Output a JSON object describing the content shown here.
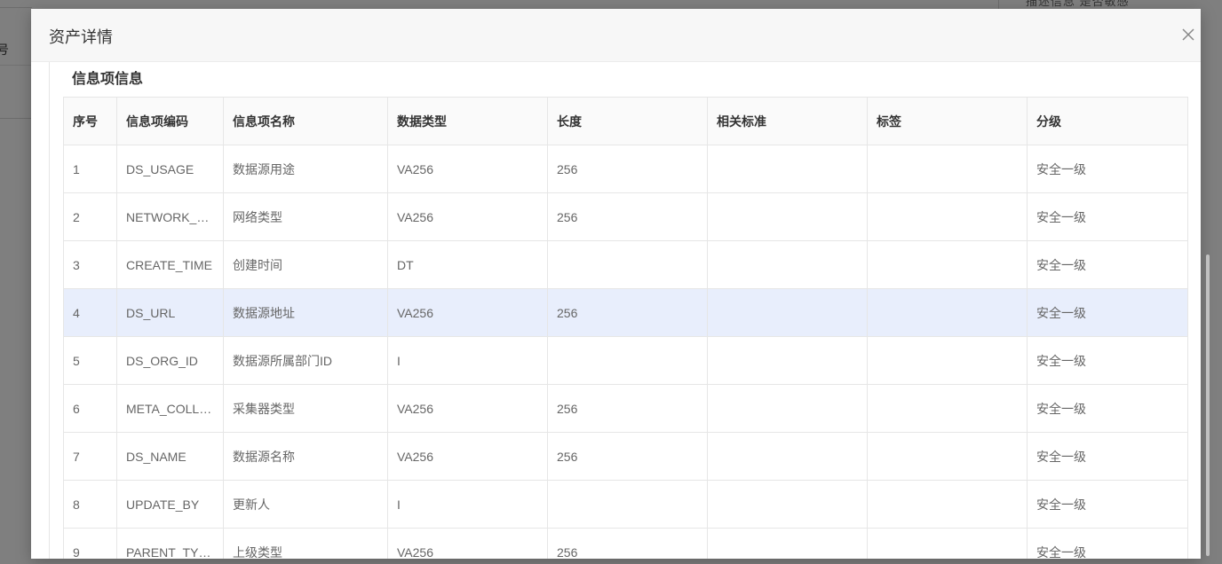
{
  "background": {
    "left_cell_text": "号",
    "top_right_text": "描述信息 是否敏感"
  },
  "modal": {
    "title": "资产详情",
    "close_icon": "close-icon",
    "section": {
      "title": "信息项信息"
    },
    "table": {
      "columns": [
        "序号",
        "信息项编码",
        "信息项名称",
        "数据类型",
        "长度",
        "相关标准",
        "标签",
        "分级"
      ],
      "rows": [
        [
          "1",
          "DS_USAGE",
          "数据源用途",
          "VA256",
          "256",
          "",
          "",
          "安全一级"
        ],
        [
          "2",
          "NETWORK_TYPE",
          "网络类型",
          "VA256",
          "256",
          "",
          "",
          "安全一级"
        ],
        [
          "3",
          "CREATE_TIME",
          "创建时间",
          "DT",
          "",
          "",
          "",
          "安全一级"
        ],
        [
          "4",
          "DS_URL",
          "数据源地址",
          "VA256",
          "256",
          "",
          "",
          "安全一级"
        ],
        [
          "5",
          "DS_ORG_ID",
          "数据源所属部门ID",
          "I",
          "",
          "",
          "",
          "安全一级"
        ],
        [
          "6",
          "META_COLLECTOR_TYPE",
          "采集器类型",
          "VA256",
          "256",
          "",
          "",
          "安全一级"
        ],
        [
          "7",
          "DS_NAME",
          "数据源名称",
          "VA256",
          "256",
          "",
          "",
          "安全一级"
        ],
        [
          "8",
          "UPDATE_BY",
          "更新人",
          "I",
          "",
          "",
          "",
          "安全一级"
        ],
        [
          "9",
          "PARENT_TYPE",
          "上级类型",
          "VA256",
          "256",
          "",
          "",
          "安全一级"
        ]
      ],
      "highlighted_row": 3
    }
  },
  "colors": {
    "overlay": "#7f7f7f",
    "header_bg": "#f7f7f7",
    "row_highlight": "#e8eefc",
    "border": "#e6e6e6"
  }
}
